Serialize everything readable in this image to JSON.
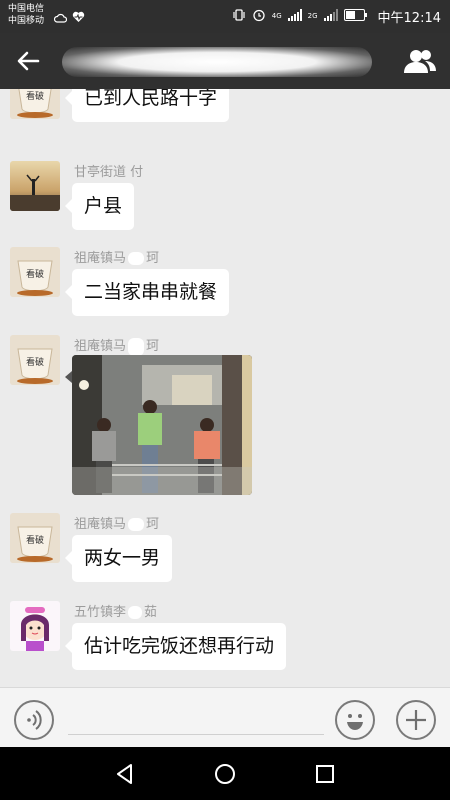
{
  "status_bar": {
    "carrier_1": "中国电信",
    "carrier_2": "中国移动",
    "network_1": "4G",
    "network_2": "2G",
    "time": "中午12:14",
    "icons": [
      "cloud-icon",
      "health-icon",
      "vibrate-icon",
      "alarm-icon",
      "signal-icon",
      "battery-icon"
    ]
  },
  "title_bar": {
    "back_icon": "arrow-left-icon",
    "title_redacted": true,
    "contacts_icon": "group-icon"
  },
  "messages": [
    {
      "sender": "",
      "avatar": "teacup-avatar",
      "type": "text",
      "text": "已到人民路十字"
    },
    {
      "sender": "甘亭街道 付",
      "avatar": "landscape-avatar",
      "type": "text",
      "text": "户县"
    },
    {
      "sender": "祖庵镇马",
      "sender_suffix": "珂",
      "avatar": "teacup-avatar",
      "type": "text",
      "text": "二当家串串就餐"
    },
    {
      "sender": "祖庵镇马",
      "sender_suffix": "珂",
      "avatar": "teacup-avatar",
      "type": "image",
      "image_desc": "photo-icon"
    },
    {
      "sender": "祖庵镇马",
      "sender_suffix": "珂",
      "avatar": "teacup-avatar",
      "type": "text",
      "text": "两女一男"
    },
    {
      "sender": "五竹镇李",
      "sender_suffix": "茹",
      "avatar": "cartoon-girl-avatar",
      "type": "text",
      "text": "估计吃完饭还想再行动"
    }
  ],
  "input_bar": {
    "voice_icon": "voice-icon",
    "emoji_icon": "smiley-icon",
    "plus_icon": "plus-icon"
  },
  "nav_bar": {
    "icons": [
      "back-triangle-icon",
      "home-circle-icon",
      "recents-square-icon"
    ]
  }
}
